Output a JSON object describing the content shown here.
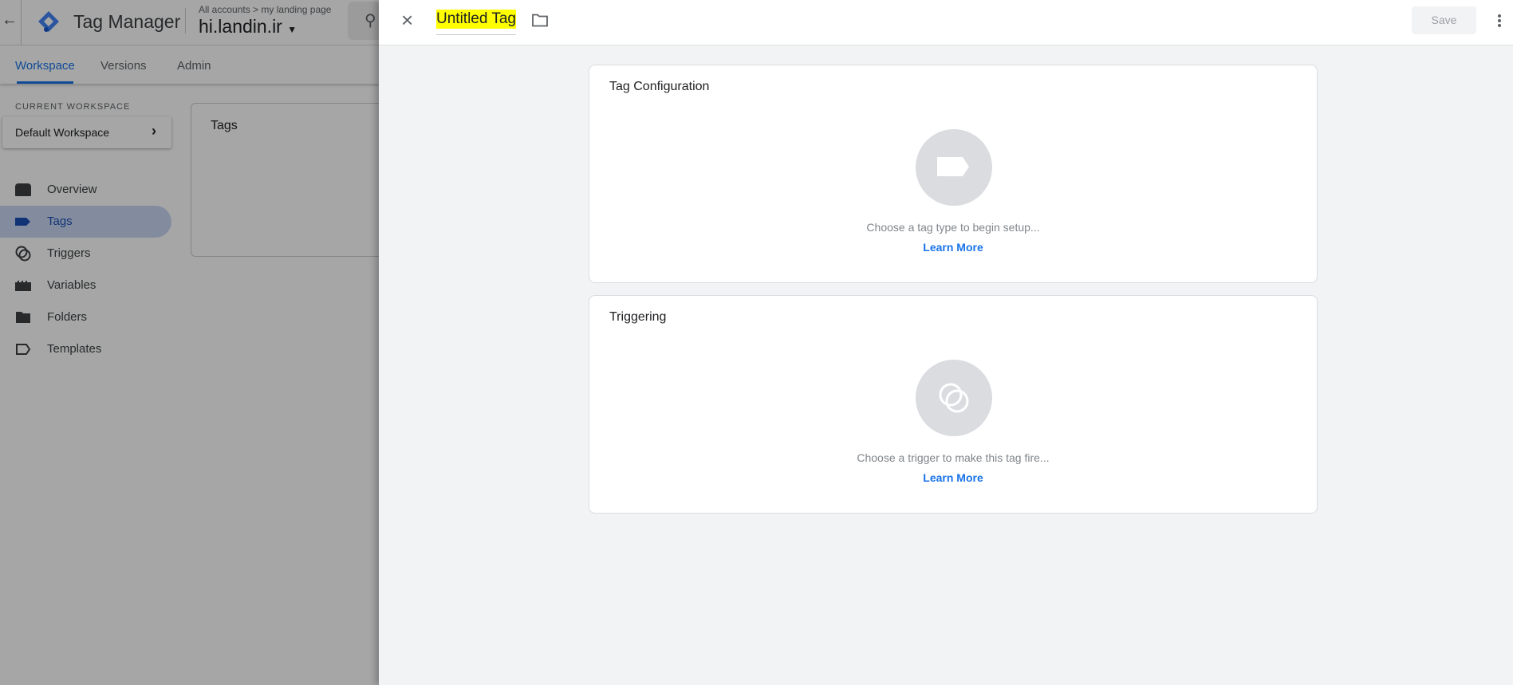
{
  "app": {
    "name": "Tag Manager",
    "breadcrumb": {
      "accounts": "All accounts",
      "separator": ">",
      "account": "my landing page"
    },
    "container": "hi.landin.ir"
  },
  "tabs": [
    {
      "label": "Workspace",
      "active": true
    },
    {
      "label": "Versions"
    },
    {
      "label": "Admin"
    }
  ],
  "sidebar": {
    "current_workspace_label": "CURRENT WORKSPACE",
    "workspace": "Default Workspace",
    "items": [
      {
        "label": "Overview",
        "icon": "overview-icon"
      },
      {
        "label": "Tags",
        "icon": "tag-icon",
        "active": true
      },
      {
        "label": "Triggers",
        "icon": "trigger-icon"
      },
      {
        "label": "Variables",
        "icon": "variables-icon"
      },
      {
        "label": "Folders",
        "icon": "folder-icon"
      },
      {
        "label": "Templates",
        "icon": "template-icon"
      }
    ]
  },
  "main": {
    "tags_card_title": "Tags"
  },
  "panel": {
    "title": "Untitled Tag",
    "save_label": "Save",
    "tag_config": {
      "title": "Tag Configuration",
      "hint": "Choose a tag type to begin setup...",
      "link": "Learn More"
    },
    "triggering": {
      "title": "Triggering",
      "hint": "Choose a trigger to make this tag fire...",
      "link": "Learn More"
    }
  },
  "colors": {
    "accent": "#1a73e8",
    "title_highlight": "#ffff00",
    "panel_bg": "#f1f3f4"
  }
}
